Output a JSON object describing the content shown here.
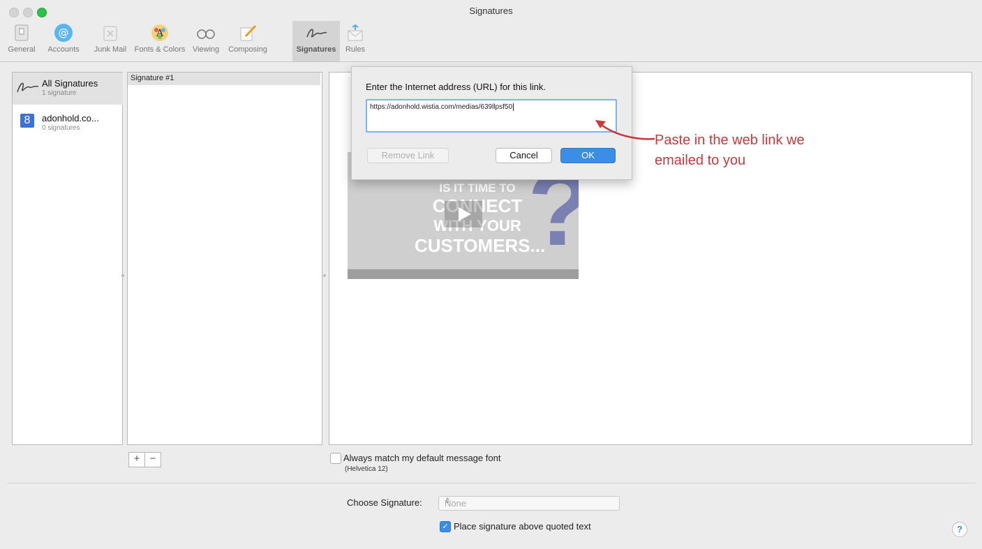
{
  "window": {
    "title": "Signatures"
  },
  "toolbar": {
    "items": [
      {
        "label": "General",
        "icon": "general-switch-icon"
      },
      {
        "label": "Accounts",
        "icon": "at-sign-icon"
      },
      {
        "label": "Junk Mail",
        "icon": "junk-trash-icon"
      },
      {
        "label": "Fonts & Colors",
        "icon": "font-palette-icon"
      },
      {
        "label": "Viewing",
        "icon": "glasses-icon"
      },
      {
        "label": "Composing",
        "icon": "pencil-icon"
      },
      {
        "label": "Signatures",
        "icon": "signature-icon",
        "active": true
      },
      {
        "label": "Rules",
        "icon": "rules-envelope-icon"
      }
    ]
  },
  "accounts": [
    {
      "name": "All Signatures",
      "count": "1 signature",
      "icon": "signature-icon"
    },
    {
      "name": "adonhold.co...",
      "count": "0 signatures",
      "icon": "google-icon"
    }
  ],
  "signatures": {
    "items": [
      "Signature #1"
    ],
    "add_label": "+",
    "remove_label": "−"
  },
  "preview": {
    "video_text": [
      "IS IT TIME TO",
      "CONNECT",
      "WITH YOUR",
      "CUSTOMERS..."
    ],
    "video_qmark": "?",
    "match_font_label": "Always match my default message font",
    "match_font_sub": "(Helvetica 12)",
    "match_font_checked": false
  },
  "footer": {
    "choose_label": "Choose Signature:",
    "choose_value": "None",
    "place_above_label": "Place signature above quoted text",
    "place_above_checked": true,
    "help": "?"
  },
  "dialog": {
    "prompt": "Enter the Internet address (URL) for this link.",
    "url_value": "https://adonhold.wistia.com/medias/639llpsf50",
    "remove_label": "Remove Link",
    "cancel_label": "Cancel",
    "ok_label": "OK"
  },
  "annotation": {
    "line1": "Paste in the web link we",
    "line2": "emailed to you",
    "color": "#c8393c"
  },
  "colors": {
    "accent": "#3a8ee6",
    "close": "#cfcfcf",
    "zoom": "#2fc24a"
  }
}
